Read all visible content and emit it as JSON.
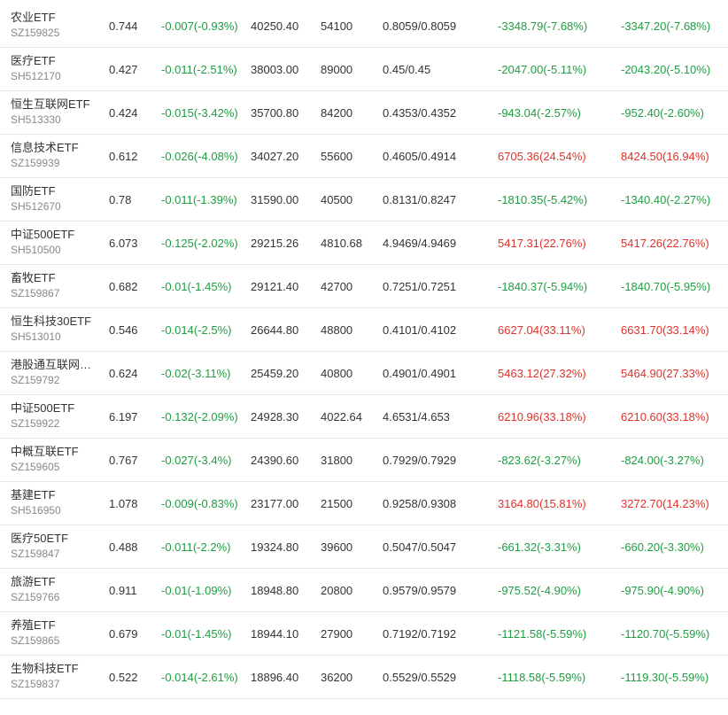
{
  "colors": {
    "up": "#e0322b",
    "down": "#1e9e41",
    "text": "#333333",
    "code": "#888888"
  },
  "rows": [
    {
      "name": "农业ETF",
      "code": "SZ159825",
      "price": "0.744",
      "change": "-0.007(-0.93%)",
      "amount": "40250.40",
      "shares": "54100",
      "nav": "0.8059/0.8059",
      "flow1": "-3348.79(-7.68%)",
      "flow2": "-3347.20(-7.68%)",
      "change_dir": "down",
      "flow1_dir": "down",
      "flow2_dir": "down"
    },
    {
      "name": "医疗ETF",
      "code": "SH512170",
      "price": "0.427",
      "change": "-0.011(-2.51%)",
      "amount": "38003.00",
      "shares": "89000",
      "nav": "0.45/0.45",
      "flow1": "-2047.00(-5.11%)",
      "flow2": "-2043.20(-5.10%)",
      "change_dir": "down",
      "flow1_dir": "down",
      "flow2_dir": "down"
    },
    {
      "name": "恒生互联网ETF",
      "code": "SH513330",
      "price": "0.424",
      "change": "-0.015(-3.42%)",
      "amount": "35700.80",
      "shares": "84200",
      "nav": "0.4353/0.4352",
      "flow1": "-943.04(-2.57%)",
      "flow2": "-952.40(-2.60%)",
      "change_dir": "down",
      "flow1_dir": "down",
      "flow2_dir": "down"
    },
    {
      "name": "信息技术ETF",
      "code": "SZ159939",
      "price": "0.612",
      "change": "-0.026(-4.08%)",
      "amount": "34027.20",
      "shares": "55600",
      "nav": "0.4605/0.4914",
      "flow1": "6705.36(24.54%)",
      "flow2": "8424.50(16.94%)",
      "change_dir": "down",
      "flow1_dir": "up",
      "flow2_dir": "up"
    },
    {
      "name": "国防ETF",
      "code": "SH512670",
      "price": "0.78",
      "change": "-0.011(-1.39%)",
      "amount": "31590.00",
      "shares": "40500",
      "nav": "0.8131/0.8247",
      "flow1": "-1810.35(-5.42%)",
      "flow2": "-1340.40(-2.27%)",
      "change_dir": "down",
      "flow1_dir": "down",
      "flow2_dir": "down"
    },
    {
      "name": "中证500ETF",
      "code": "SH510500",
      "price": "6.073",
      "change": "-0.125(-2.02%)",
      "amount": "29215.26",
      "shares": "4810.68",
      "nav": "4.9469/4.9469",
      "flow1": "5417.31(22.76%)",
      "flow2": "5417.26(22.76%)",
      "change_dir": "down",
      "flow1_dir": "up",
      "flow2_dir": "up"
    },
    {
      "name": "畜牧ETF",
      "code": "SZ159867",
      "price": "0.682",
      "change": "-0.01(-1.45%)",
      "amount": "29121.40",
      "shares": "42700",
      "nav": "0.7251/0.7251",
      "flow1": "-1840.37(-5.94%)",
      "flow2": "-1840.70(-5.95%)",
      "change_dir": "down",
      "flow1_dir": "down",
      "flow2_dir": "down"
    },
    {
      "name": "恒生科技30ETF",
      "code": "SH513010",
      "price": "0.546",
      "change": "-0.014(-2.5%)",
      "amount": "26644.80",
      "shares": "48800",
      "nav": "0.4101/0.4102",
      "flow1": "6627.04(33.11%)",
      "flow2": "6631.70(33.14%)",
      "change_dir": "down",
      "flow1_dir": "up",
      "flow2_dir": "up"
    },
    {
      "name": "港股通互联网…",
      "code": "SZ159792",
      "price": "0.624",
      "change": "-0.02(-3.11%)",
      "amount": "25459.20",
      "shares": "40800",
      "nav": "0.4901/0.4901",
      "flow1": "5463.12(27.32%)",
      "flow2": "5464.90(27.33%)",
      "change_dir": "down",
      "flow1_dir": "up",
      "flow2_dir": "up"
    },
    {
      "name": "中证500ETF",
      "code": "SZ159922",
      "price": "6.197",
      "change": "-0.132(-2.09%)",
      "amount": "24928.30",
      "shares": "4022.64",
      "nav": "4.6531/4.653",
      "flow1": "6210.96(33.18%)",
      "flow2": "6210.60(33.18%)",
      "change_dir": "down",
      "flow1_dir": "up",
      "flow2_dir": "up"
    },
    {
      "name": "中概互联ETF",
      "code": "SZ159605",
      "price": "0.767",
      "change": "-0.027(-3.4%)",
      "amount": "24390.60",
      "shares": "31800",
      "nav": "0.7929/0.7929",
      "flow1": "-823.62(-3.27%)",
      "flow2": "-824.00(-3.27%)",
      "change_dir": "down",
      "flow1_dir": "down",
      "flow2_dir": "down"
    },
    {
      "name": "基建ETF",
      "code": "SH516950",
      "price": "1.078",
      "change": "-0.009(-0.83%)",
      "amount": "23177.00",
      "shares": "21500",
      "nav": "0.9258/0.9308",
      "flow1": "3164.80(15.81%)",
      "flow2": "3272.70(14.23%)",
      "change_dir": "down",
      "flow1_dir": "up",
      "flow2_dir": "up"
    },
    {
      "name": "医疗50ETF",
      "code": "SZ159847",
      "price": "0.488",
      "change": "-0.011(-2.2%)",
      "amount": "19324.80",
      "shares": "39600",
      "nav": "0.5047/0.5047",
      "flow1": "-661.32(-3.31%)",
      "flow2": "-660.20(-3.30%)",
      "change_dir": "down",
      "flow1_dir": "down",
      "flow2_dir": "down"
    },
    {
      "name": "旅游ETF",
      "code": "SZ159766",
      "price": "0.911",
      "change": "-0.01(-1.09%)",
      "amount": "18948.80",
      "shares": "20800",
      "nav": "0.9579/0.9579",
      "flow1": "-975.52(-4.90%)",
      "flow2": "-975.90(-4.90%)",
      "change_dir": "down",
      "flow1_dir": "down",
      "flow2_dir": "down"
    },
    {
      "name": "养殖ETF",
      "code": "SZ159865",
      "price": "0.679",
      "change": "-0.01(-1.45%)",
      "amount": "18944.10",
      "shares": "27900",
      "nav": "0.7192/0.7192",
      "flow1": "-1121.58(-5.59%)",
      "flow2": "-1120.70(-5.59%)",
      "change_dir": "down",
      "flow1_dir": "down",
      "flow2_dir": "down"
    },
    {
      "name": "生物科技ETF",
      "code": "SZ159837",
      "price": "0.522",
      "change": "-0.014(-2.61%)",
      "amount": "18896.40",
      "shares": "36200",
      "nav": "0.5529/0.5529",
      "flow1": "-1118.58(-5.59%)",
      "flow2": "-1119.30(-5.59%)",
      "change_dir": "down",
      "flow1_dir": "down",
      "flow2_dir": "down"
    }
  ]
}
